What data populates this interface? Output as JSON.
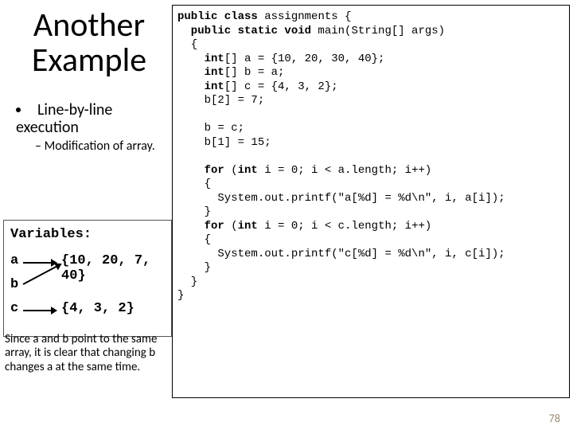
{
  "title": "Another Example",
  "bullet": "Line-by-line execution",
  "subbullet": "Modification of array.",
  "variables": {
    "heading": "Variables:",
    "a": {
      "name": "a",
      "value": "{10, 20, 7, 40}"
    },
    "b": {
      "name": "b"
    },
    "c": {
      "name": "c",
      "value": "{4, 3, 2}"
    }
  },
  "note": "Since a and b point to the same array, it is clear that changing b changes a at the same time.",
  "code": {
    "l1a": "public class",
    "l1b": " assignments {",
    "l2a": "  public static void",
    "l2b": " main(String[] args)",
    "l3": "  {",
    "l4a": "    int",
    "l4b": "[] a = {10, 20, 30, 40};",
    "l5a": "    int",
    "l5b": "[] b = a;",
    "l6a": "    int",
    "l6b": "[] c = {4, 3, 2};",
    "l7": "    b[2] = 7;",
    "blank1": "",
    "l8": "    b = c;",
    "l9": "    b[1] = 15;",
    "blank2": "",
    "l10a": "    for",
    "l10b": " (",
    "l10c": "int",
    "l10d": " i = 0; i < a.length; i++)",
    "l11": "    {",
    "l12": "      System.out.printf(\"a[%d] = %d\\n\", i, a[i]);",
    "l13": "    }",
    "l14a": "    for",
    "l14b": " (",
    "l14c": "int",
    "l14d": " i = 0; i < c.length; i++)",
    "l15": "    {",
    "l16": "      System.out.printf(\"c[%d] = %d\\n\", i, c[i]);",
    "l17": "    }",
    "l18": "  }",
    "l19": "}"
  },
  "page_number": "78"
}
